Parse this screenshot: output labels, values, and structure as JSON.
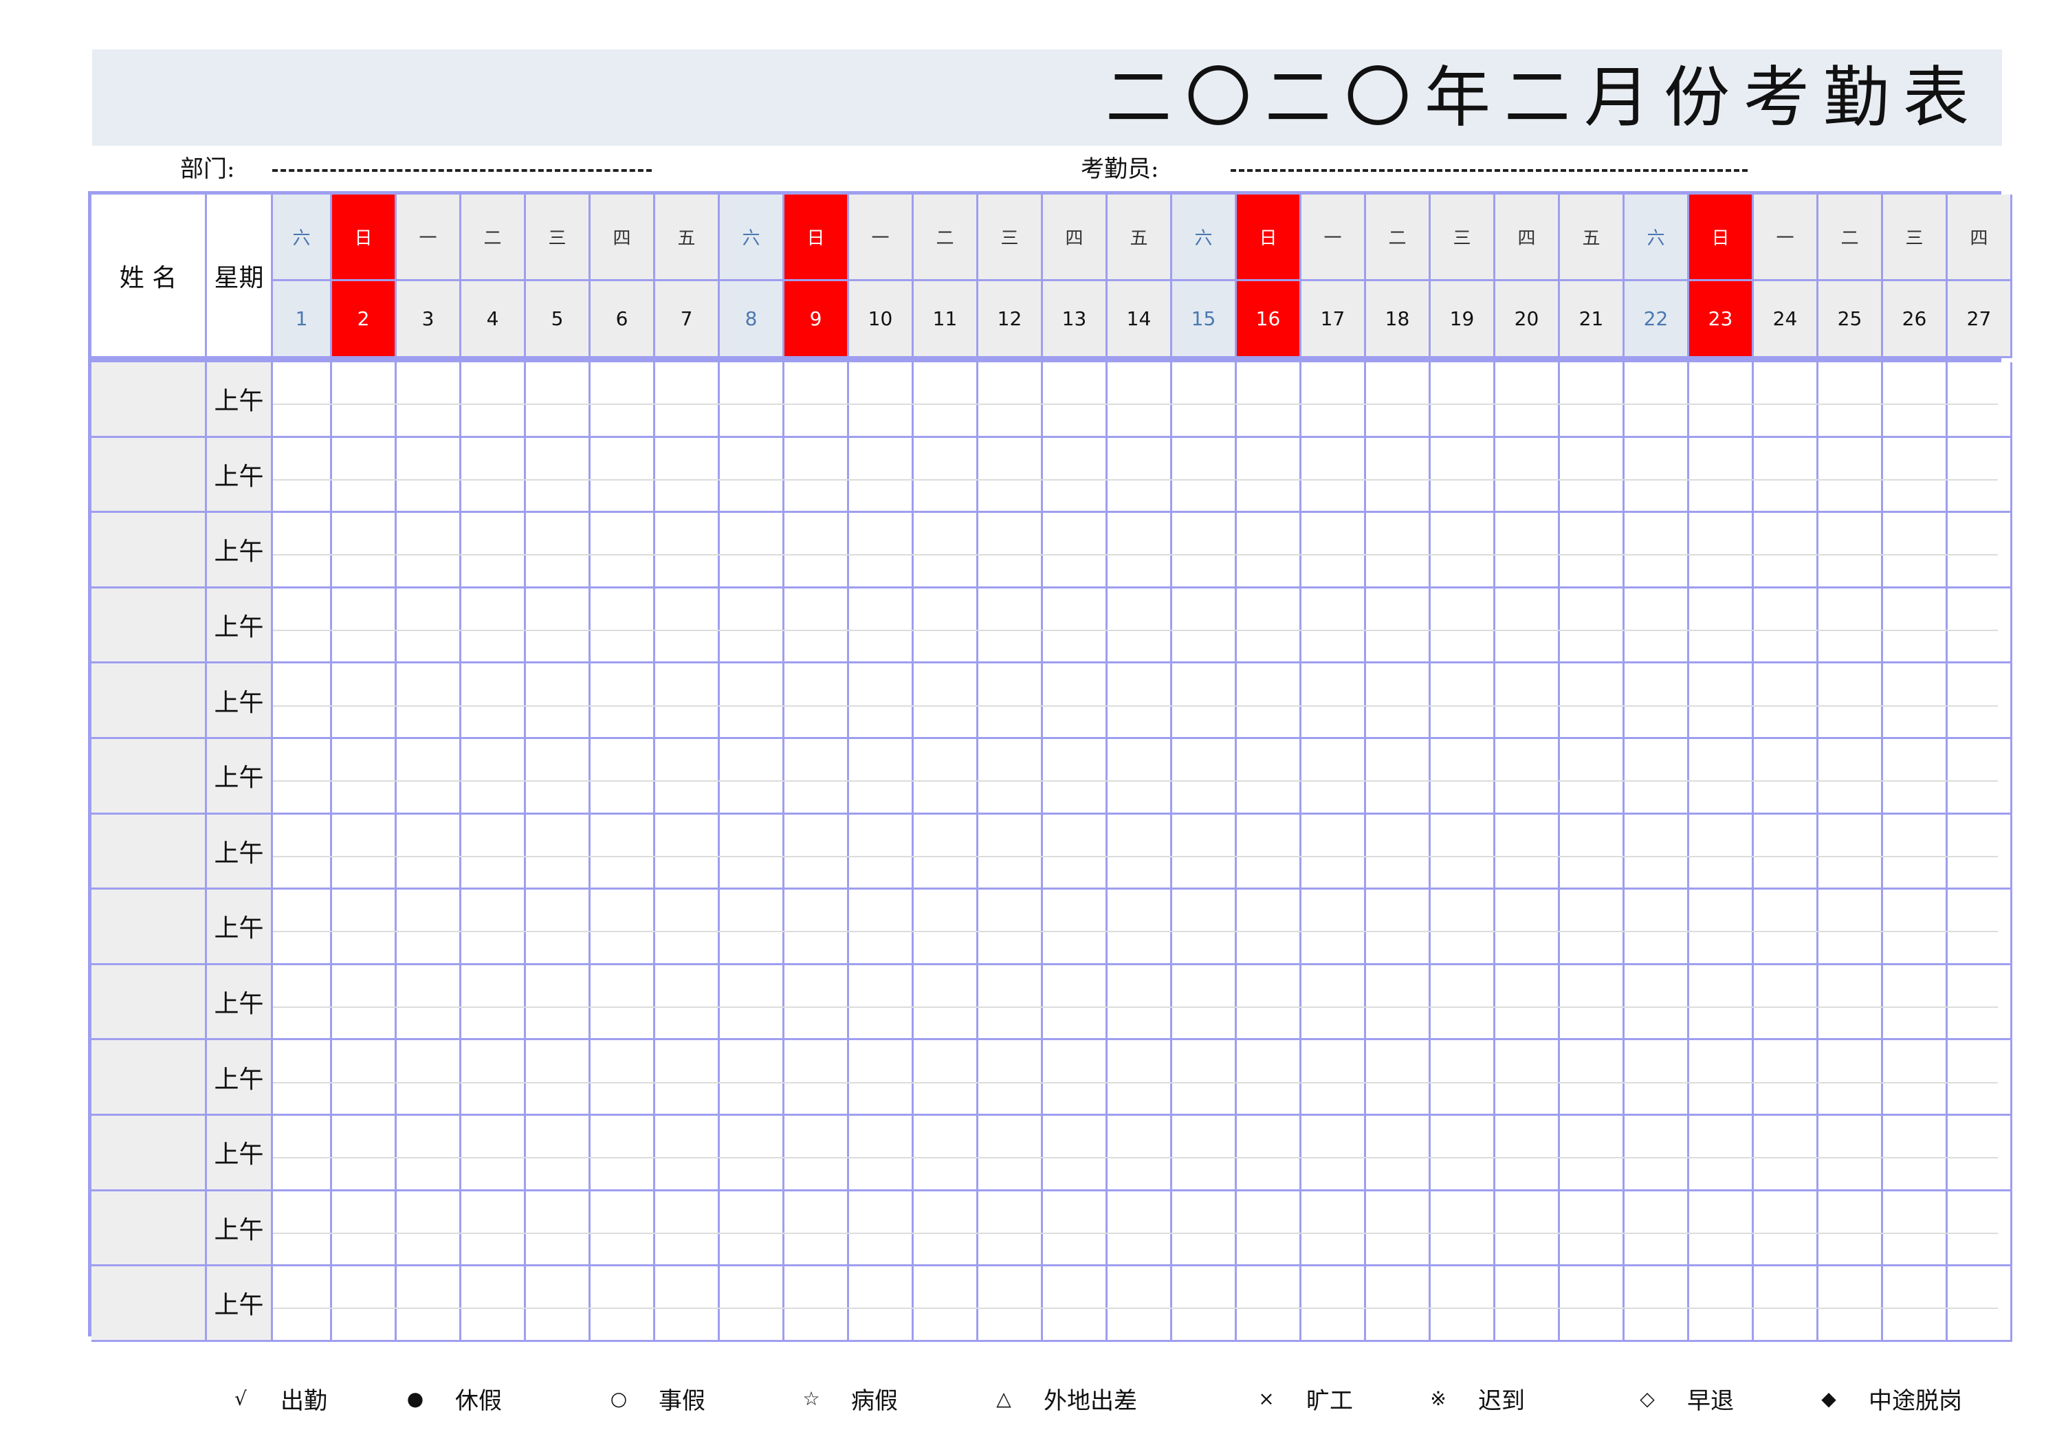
{
  "title": "二〇二〇年二月份考勤表",
  "fields": {
    "department_label": "部门:",
    "attendant_label": "考勤员:"
  },
  "table": {
    "name_header": "姓 名",
    "weekday_header": "星期",
    "period_label": "上午",
    "row_count": 13,
    "days": [
      {
        "weekday": "六",
        "num": "1",
        "type": "sat"
      },
      {
        "weekday": "日",
        "num": "2",
        "type": "sun"
      },
      {
        "weekday": "一",
        "num": "3",
        "type": "wd"
      },
      {
        "weekday": "二",
        "num": "4",
        "type": "wd"
      },
      {
        "weekday": "三",
        "num": "5",
        "type": "wd"
      },
      {
        "weekday": "四",
        "num": "6",
        "type": "wd"
      },
      {
        "weekday": "五",
        "num": "7",
        "type": "wd"
      },
      {
        "weekday": "六",
        "num": "8",
        "type": "sat"
      },
      {
        "weekday": "日",
        "num": "9",
        "type": "sun"
      },
      {
        "weekday": "一",
        "num": "10",
        "type": "wd"
      },
      {
        "weekday": "二",
        "num": "11",
        "type": "wd"
      },
      {
        "weekday": "三",
        "num": "12",
        "type": "wd"
      },
      {
        "weekday": "四",
        "num": "13",
        "type": "wd"
      },
      {
        "weekday": "五",
        "num": "14",
        "type": "wd"
      },
      {
        "weekday": "六",
        "num": "15",
        "type": "sat"
      },
      {
        "weekday": "日",
        "num": "16",
        "type": "sun"
      },
      {
        "weekday": "一",
        "num": "17",
        "type": "wd"
      },
      {
        "weekday": "二",
        "num": "18",
        "type": "wd"
      },
      {
        "weekday": "三",
        "num": "19",
        "type": "wd"
      },
      {
        "weekday": "四",
        "num": "20",
        "type": "wd"
      },
      {
        "weekday": "五",
        "num": "21",
        "type": "wd"
      },
      {
        "weekday": "六",
        "num": "22",
        "type": "sat"
      },
      {
        "weekday": "日",
        "num": "23",
        "type": "sun"
      },
      {
        "weekday": "一",
        "num": "24",
        "type": "wd"
      },
      {
        "weekday": "二",
        "num": "25",
        "type": "wd"
      },
      {
        "weekday": "三",
        "num": "26",
        "type": "wd"
      },
      {
        "weekday": "四",
        "num": "27",
        "type": "wd"
      }
    ]
  },
  "legend": [
    {
      "symbol": "√",
      "label": "出勤"
    },
    {
      "symbol": "●",
      "label": "休假"
    },
    {
      "symbol": "○",
      "label": "事假"
    },
    {
      "symbol": "☆",
      "label": "病假"
    },
    {
      "symbol": "△",
      "label": "外地出差"
    },
    {
      "symbol": "×",
      "label": "旷工"
    },
    {
      "symbol": "※",
      "label": "迟到"
    },
    {
      "symbol": "◇",
      "label": "早退"
    },
    {
      "symbol": "◆",
      "label": "中途脱岗"
    }
  ],
  "colors": {
    "grid": "#9e9ef0",
    "sunday": "#ff0000",
    "saturday_text": "#4a78b0",
    "banner": "#e8edf3"
  }
}
